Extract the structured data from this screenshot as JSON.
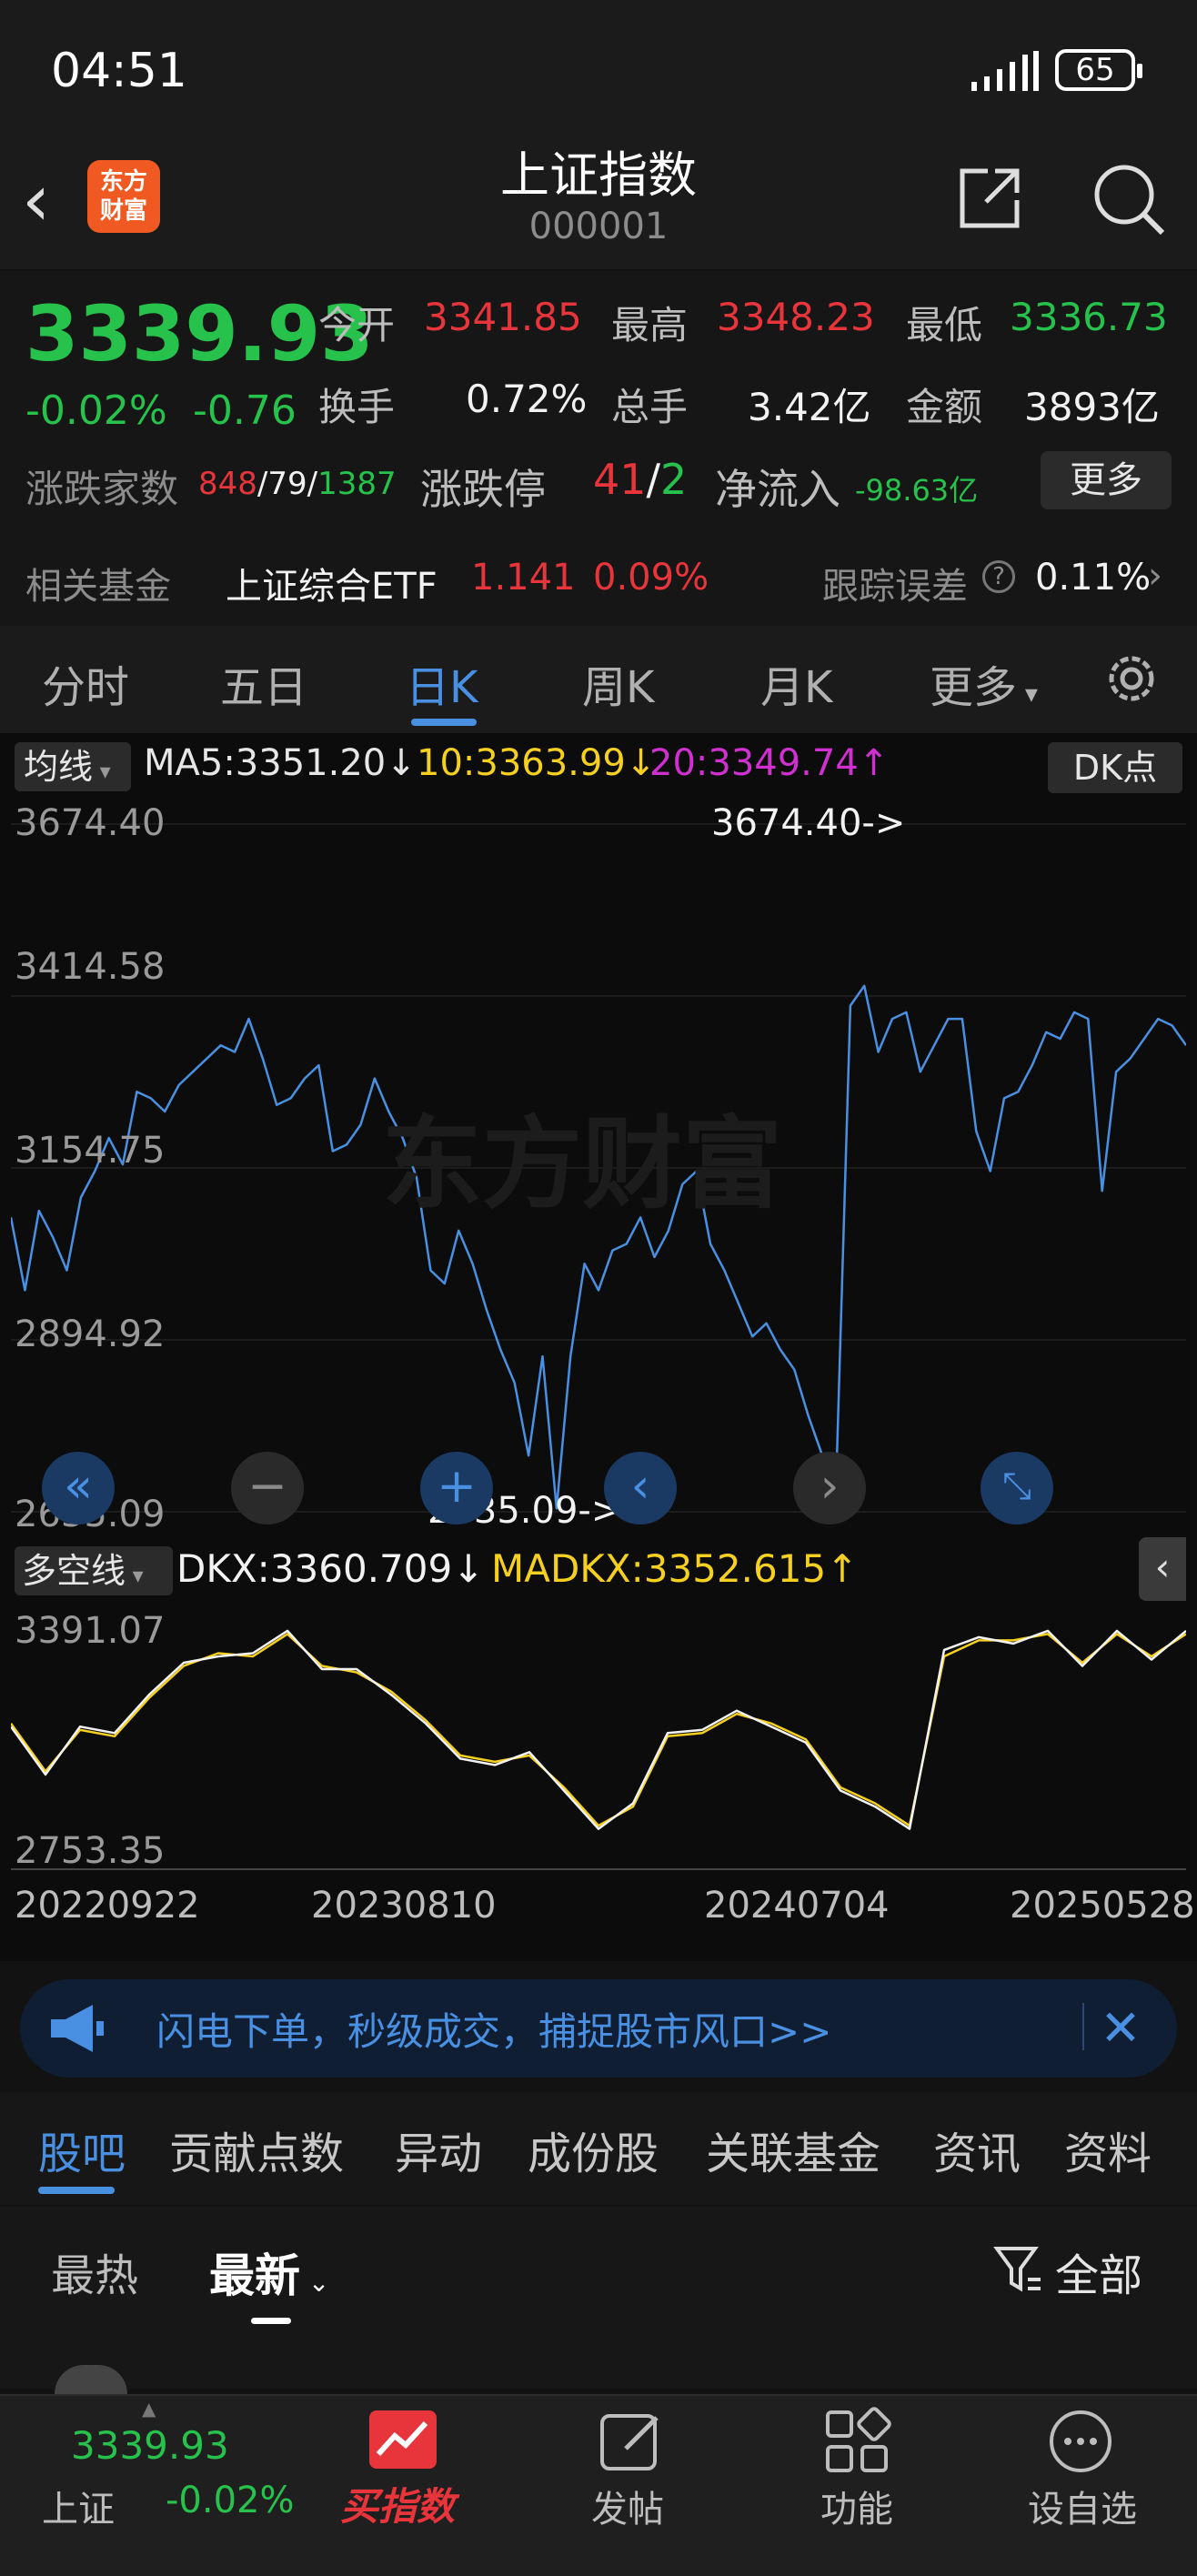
{
  "status": {
    "time": "04:51",
    "battery": "65"
  },
  "header": {
    "title": "上证指数",
    "code": "000001",
    "logo_line1": "东方",
    "logo_line2": "财富"
  },
  "quote": {
    "price": "3339.93",
    "change_pct": "-0.02%",
    "change": "-0.76",
    "open_label": "今开",
    "open": "3341.85",
    "high_label": "最高",
    "high": "3348.23",
    "low_label": "最低",
    "low": "3336.73",
    "turnover_label": "换手",
    "turnover": "0.72%",
    "volume_label": "总手",
    "volume": "3.42亿",
    "amount_label": "金额",
    "amount": "3893亿",
    "breadth_label": "涨跌家数",
    "breadth_up": "848",
    "breadth_flat": "79",
    "breadth_down": "1387",
    "limit_label": "涨跌停",
    "limit_up": "41",
    "limit_down": "2",
    "inflow_label": "净流入",
    "inflow": "-98.63亿",
    "more_label": "更多",
    "fund_label": "相关基金",
    "fund_name": "上证综合ETF",
    "fund_price": "1.141",
    "fund_pct": "0.09%",
    "track_label": "跟踪误差",
    "track_value": "0.11%"
  },
  "tabs": [
    "分时",
    "五日",
    "日K",
    "周K",
    "月K",
    "更多"
  ],
  "active_tab": "日K",
  "chart_header": {
    "ma_btn": "均线",
    "ma5": "MA5:3351.20",
    "ma10": "10:3363.99",
    "ma20": "20:3349.74",
    "dk_btn": "DK点"
  },
  "indicator_header": {
    "sel": "多空线",
    "dkx": "DKX:3360.709",
    "madkx": "MADKX:3352.615"
  },
  "colors": {
    "up": "#e8353b",
    "down": "#27c24c",
    "accent": "#4a90e2",
    "ma10": "#f5d020",
    "ma20": "#d030d0"
  },
  "chart_data": [
    {
      "type": "line",
      "ylim": [
        2635.09,
        3674.4
      ],
      "y_ticks": [
        "3674.40",
        "3414.58",
        "3154.75",
        "2894.92",
        "2635.09"
      ],
      "annotations": [
        "3674.40->",
        "2635.09->"
      ],
      "series": [
        {
          "values": [
            3080,
            2970,
            3090,
            3050,
            3000,
            3110,
            3150,
            3200,
            3160,
            3270,
            3260,
            3240,
            3280,
            3300,
            3320,
            3340,
            3330,
            3380,
            3320,
            3250,
            3260,
            3290,
            3310,
            3180,
            3190,
            3220,
            3290,
            3240,
            3200,
            3140,
            3000,
            2980,
            3060,
            3010,
            2940,
            2880,
            2830,
            2720,
            2870,
            2640,
            2870,
            3010,
            2970,
            3030,
            3040,
            3080,
            3020,
            3060,
            3130,
            3150,
            3040,
            3000,
            2950,
            2900,
            2920,
            2880,
            2850,
            2780,
            2720,
            2690,
            3400,
            3430,
            3330,
            3380,
            3390,
            3300,
            3340,
            3380,
            3380,
            3210,
            3150,
            3260,
            3270,
            3310,
            3360,
            3350,
            3390,
            3380,
            3120,
            3300,
            3320,
            3350,
            3380,
            3370,
            3340
          ]
        }
      ]
    },
    {
      "type": "line",
      "ylim": [
        2753.35,
        3391.07
      ],
      "y_ticks": [
        "3391.07",
        "2753.35"
      ],
      "x_ticks": [
        "20220922",
        "20230810",
        "20240704",
        "20250528"
      ],
      "series": [
        {
          "name": "DKX",
          "values": [
            3100,
            2950,
            3100,
            3080,
            3200,
            3300,
            3320,
            3330,
            3400,
            3280,
            3280,
            3200,
            3110,
            3000,
            2980,
            3020,
            2900,
            2780,
            2860,
            3080,
            3090,
            3150,
            3100,
            3050,
            2900,
            2850,
            2780,
            3340,
            3380,
            3360,
            3400,
            3290,
            3400,
            3310,
            3400
          ]
        },
        {
          "name": "MADKX",
          "values": [
            3110,
            2960,
            3090,
            3070,
            3190,
            3290,
            3330,
            3320,
            3390,
            3290,
            3270,
            3210,
            3120,
            3010,
            2990,
            3010,
            2910,
            2790,
            2850,
            3070,
            3080,
            3140,
            3110,
            3060,
            2910,
            2860,
            2790,
            3320,
            3370,
            3370,
            3390,
            3300,
            3390,
            3320,
            3390
          ]
        }
      ]
    }
  ],
  "banner": {
    "text": "闪电下单，秒级成交，捕捉股市风口>>"
  },
  "sub_tabs": [
    "股吧",
    "贡献点数",
    "异动",
    "成份股",
    "关联基金",
    "资讯",
    "资料"
  ],
  "feed": {
    "hot": "最热",
    "new": "最新",
    "all": "全部"
  },
  "bottom": {
    "index_price": "3339.93",
    "index_name": "上证",
    "index_pct": "-0.02%",
    "buy": "买指数",
    "post": "发帖",
    "func": "功能",
    "watch": "设自选"
  }
}
